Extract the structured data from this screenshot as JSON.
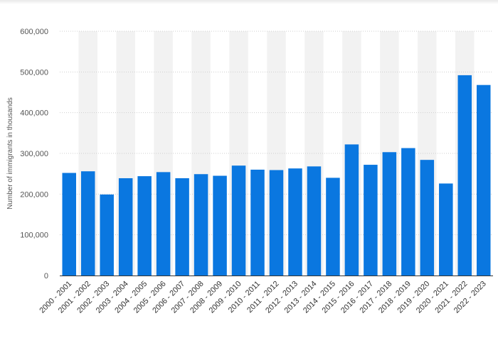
{
  "chart_data": {
    "type": "bar",
    "categories": [
      "2000 - 2001",
      "2001 - 2002",
      "2002 - 2003",
      "2003 - 2004",
      "2004 - 2005",
      "2005 - 2006",
      "2006 - 2007",
      "2007 - 2008",
      "2008 - 2009",
      "2009 - 2010",
      "2010 - 2011",
      "2011 - 2012",
      "2012 - 2013",
      "2013 - 2014",
      "2014 - 2015",
      "2015 - 2016",
      "2016 - 2017",
      "2017 - 2018",
      "2018 - 2019",
      "2019 - 2020",
      "2020 - 2021",
      "2021 - 2022",
      "2022 - 2023"
    ],
    "values": [
      252000,
      256000,
      199000,
      239000,
      244000,
      254000,
      239000,
      249000,
      245000,
      270000,
      260000,
      259000,
      263000,
      268000,
      240000,
      322000,
      272000,
      303000,
      313000,
      284000,
      226000,
      492000,
      468000
    ],
    "title": "",
    "xlabel": "",
    "ylabel": "Number of immigrants in thousands",
    "ylim": [
      0,
      600000
    ],
    "yticks": [
      "0",
      "100,000",
      "200,000",
      "300,000",
      "400,000",
      "500,000",
      "600,000"
    ],
    "grid": true,
    "bar_color": "#0a77e0",
    "band_color": "#f2f2f2"
  }
}
